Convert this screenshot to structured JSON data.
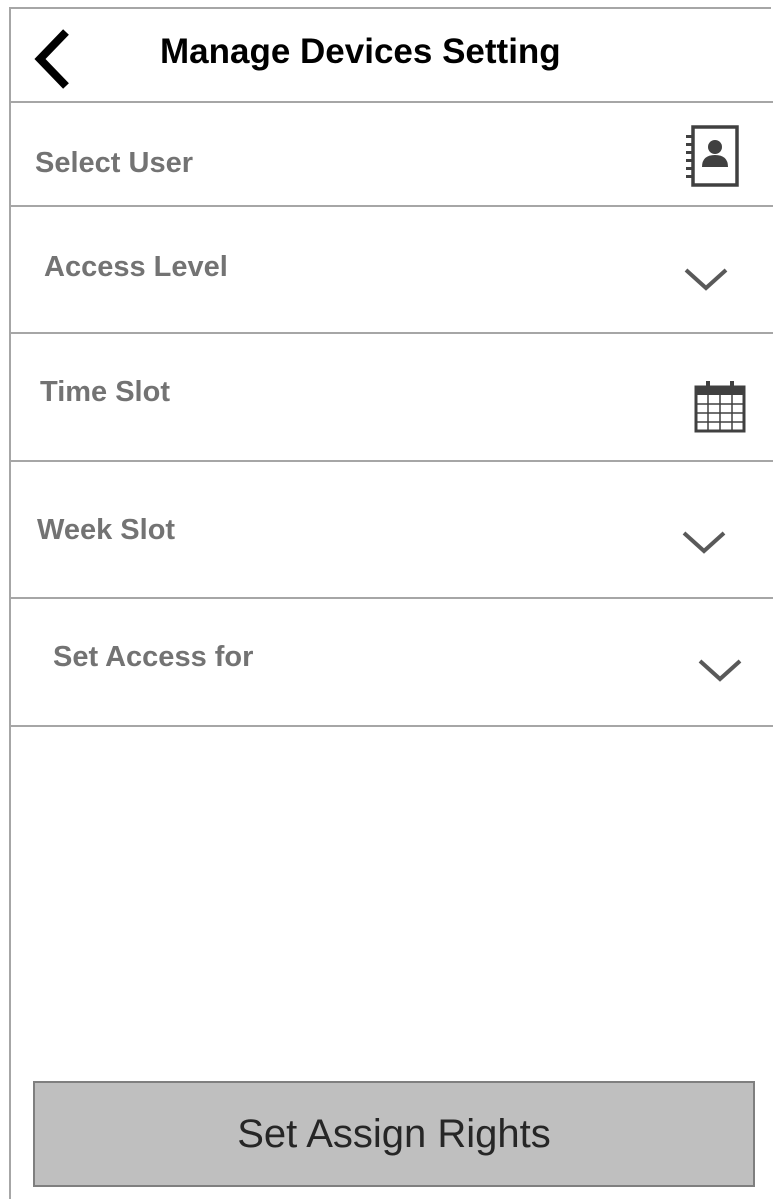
{
  "header": {
    "title": "Manage Devices  Setting",
    "back_icon": "chevron-left-icon"
  },
  "form": {
    "rows": [
      {
        "label": "Select User",
        "icon": "contact-book-icon"
      },
      {
        "label": "Access Level",
        "icon": "chevron-down-icon"
      },
      {
        "label": "Time Slot",
        "icon": "calendar-icon"
      },
      {
        "label": "Week Slot",
        "icon": "chevron-down-icon"
      },
      {
        "label": "Set Access for",
        "icon": "chevron-down-icon"
      }
    ]
  },
  "actions": {
    "submit_label": "Set Assign Rights"
  },
  "colors": {
    "label": "#737373",
    "divider": "#a6a6a6",
    "button_bg": "#bfbfbf",
    "button_border": "#7f7f7f",
    "icon": "#404040"
  }
}
